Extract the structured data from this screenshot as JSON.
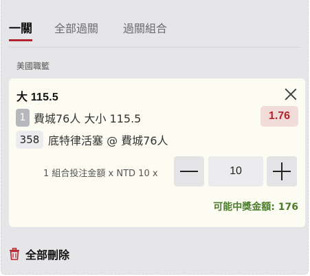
{
  "tabs": [
    {
      "label": "一關",
      "active": true
    },
    {
      "label": "全部過關",
      "active": false
    },
    {
      "label": "過關組合",
      "active": false
    }
  ],
  "league": "美國職籃",
  "bet": {
    "title": "大 115.5",
    "selection_num": "1",
    "selection": "費城76人 大小 115.5",
    "odds": "1.76",
    "match_code": "358",
    "match": "底特律活塞 @ 費城76人"
  },
  "stake": {
    "label": "1 組合投注金額 x NTD 10 x",
    "value": "10"
  },
  "payout": "可能中獎金額: 176",
  "delete_all": "全部刪除",
  "colors": {
    "accent": "#b3252c",
    "payout": "#4b7c2d",
    "card_bg": "#fdfcf3",
    "panel_bg": "#e6e6e8"
  },
  "icons": [
    "close-icon",
    "minus-icon",
    "plus-icon",
    "trash-icon"
  ]
}
